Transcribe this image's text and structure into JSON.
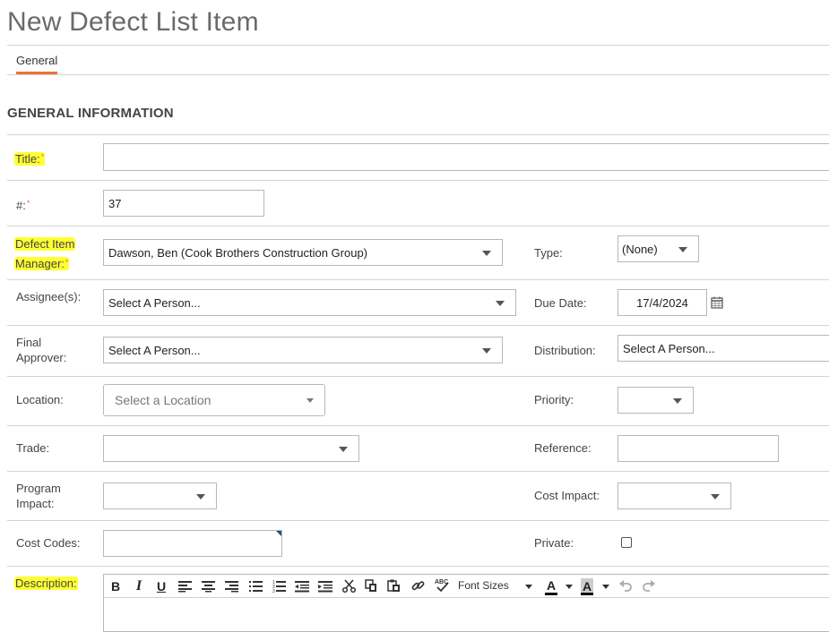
{
  "page": {
    "title": "New Defect List Item"
  },
  "tabs": [
    {
      "label": "General"
    }
  ],
  "section": {
    "title": "GENERAL INFORMATION"
  },
  "form": {
    "title_label": "Title:",
    "number_label": "#:",
    "number_value": "37",
    "manager_label_line1": "Defect Item",
    "manager_label_line2": "Manager:",
    "manager_value": "Dawson, Ben (Cook Brothers Construction Group)",
    "type_label": "Type:",
    "type_value": "(None)",
    "assignees_label": "Assignee(s):",
    "assignees_placeholder": "Select A Person...",
    "due_date_label": "Due Date:",
    "due_date_value": "17/4/2024",
    "final_approver_label_line1": "Final",
    "final_approver_label_line2": "Approver:",
    "final_approver_placeholder": "Select A Person...",
    "distribution_label": "Distribution:",
    "distribution_placeholder": "Select A Person...",
    "location_label": "Location:",
    "location_placeholder": "Select a Location",
    "priority_label": "Priority:",
    "trade_label": "Trade:",
    "reference_label": "Reference:",
    "program_impact_label_line1": "Program",
    "program_impact_label_line2": "Impact:",
    "cost_impact_label": "Cost Impact:",
    "cost_codes_label": "Cost Codes:",
    "private_label": "Private:",
    "description_label": "Description:",
    "required_marker": "*"
  },
  "editor_toolbar": {
    "bold": "B",
    "italic": "I",
    "underline": "U",
    "font_sizes": "Font Sizes",
    "font_color": "A",
    "bg_color": "A"
  },
  "colors": {
    "accent": "#e8733a",
    "highlight": "#ffff33"
  }
}
